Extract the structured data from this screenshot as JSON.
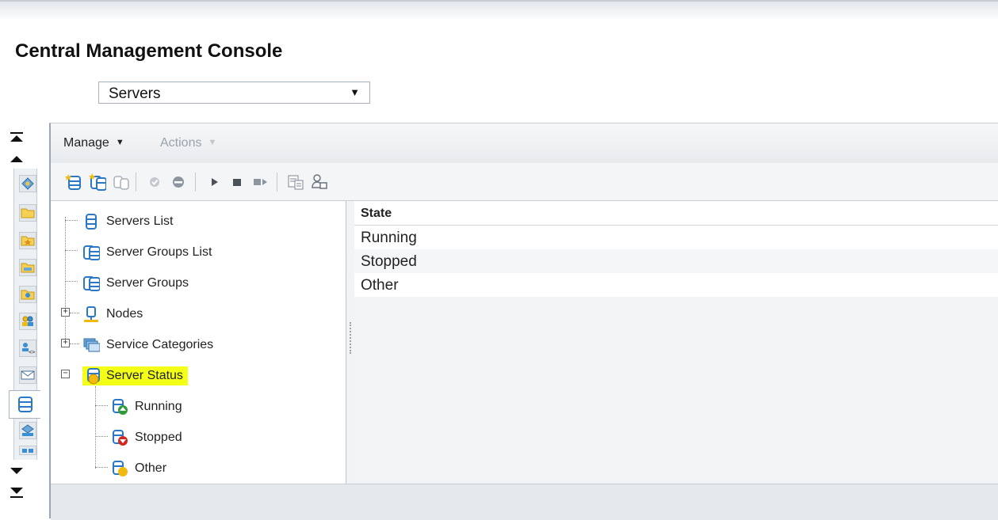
{
  "app": {
    "title": "Central Management Console"
  },
  "view_select": {
    "value": "Servers"
  },
  "menubar": {
    "manage_label": "Manage",
    "actions_label": "Actions"
  },
  "tree": {
    "servers_list": "Servers List",
    "server_groups_list": "Server Groups List",
    "server_groups": "Server Groups",
    "nodes": "Nodes",
    "service_categories": "Service Categories",
    "server_status": "Server Status",
    "running": "Running",
    "stopped": "Stopped",
    "other": "Other"
  },
  "grid": {
    "column_header": "State",
    "rows": [
      "Running",
      "Stopped",
      "Other"
    ]
  },
  "colors": {
    "highlight": "#f3ff17",
    "running_badge": "#2e9b3a",
    "stopped_badge": "#d2281e",
    "other_badge": "#f2b90f",
    "server_icon": "#3a8fd4"
  },
  "icons": {
    "rail": [
      "scroll-top-icon",
      "scroll-up-icon",
      "home-icon",
      "folder-icon",
      "personal-folder-icon",
      "categories-icon",
      "inbox-icon",
      "users-icon",
      "access-levels-icon",
      "email-icon",
      "servers-icon",
      "federation-icon",
      "scroll-down-icon",
      "scroll-bottom-icon"
    ],
    "toolbar": [
      "new-server-icon",
      "new-server-group-icon",
      "clone-server-icon",
      "enable-server-icon",
      "disable-server-icon",
      "start-server-icon",
      "stop-server-icon",
      "restart-server-icon",
      "properties-icon",
      "user-security-icon"
    ]
  }
}
